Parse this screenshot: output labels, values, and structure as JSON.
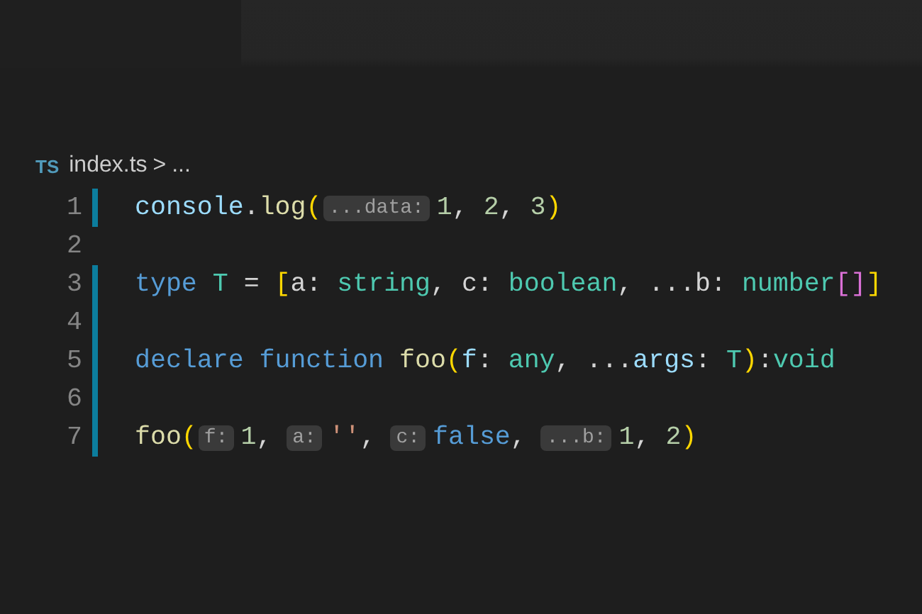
{
  "breadcrumb": {
    "language_badge": "TS",
    "file": "index.ts",
    "separator": ">",
    "rest": "..."
  },
  "lines": [
    {
      "number": "1",
      "modified": true,
      "tokens": [
        {
          "text": "console",
          "kind": "var"
        },
        {
          "text": ".",
          "kind": "punct"
        },
        {
          "text": "log",
          "kind": "fn"
        },
        {
          "text": "(",
          "kind": "bracket"
        },
        {
          "text": "...data:",
          "kind": "hint"
        },
        {
          "text": "1",
          "kind": "num"
        },
        {
          "text": ",",
          "kind": "punct"
        },
        {
          "text": "2",
          "kind": "num",
          "gap": true
        },
        {
          "text": ",",
          "kind": "punct"
        },
        {
          "text": "3",
          "kind": "num",
          "gap": true
        },
        {
          "text": ")",
          "kind": "bracket"
        }
      ]
    },
    {
      "number": "2",
      "modified": false
    },
    {
      "number": "3",
      "modified": true,
      "tokens": [
        {
          "text": "type",
          "kind": "kw"
        },
        {
          "text": "T",
          "kind": "type",
          "gap": true
        },
        {
          "text": "=",
          "kind": "punct",
          "gap": true
        },
        {
          "text": "[",
          "kind": "bracket",
          "gap": true
        },
        {
          "text": "a:",
          "kind": "punct"
        },
        {
          "text": "string",
          "kind": "type",
          "gap": true
        },
        {
          "text": ",",
          "kind": "punct"
        },
        {
          "text": "c:",
          "kind": "punct",
          "gap": true
        },
        {
          "text": "boolean",
          "kind": "type",
          "gap": true
        },
        {
          "text": ",",
          "kind": "punct"
        },
        {
          "text": "...b:",
          "kind": "punct",
          "gap": true
        },
        {
          "text": "number",
          "kind": "type",
          "gap": true
        },
        {
          "text": "[]",
          "kind": "bracket2"
        },
        {
          "text": "]",
          "kind": "bracket"
        }
      ]
    },
    {
      "number": "4",
      "modified": true
    },
    {
      "number": "5",
      "modified": true,
      "tokens": [
        {
          "text": "declare",
          "kind": "kw"
        },
        {
          "text": "function",
          "kind": "kw",
          "gap": true
        },
        {
          "text": "foo",
          "kind": "fn",
          "gap": true
        },
        {
          "text": "(",
          "kind": "bracket"
        },
        {
          "text": "f",
          "kind": "var"
        },
        {
          "text": ":",
          "kind": "punct"
        },
        {
          "text": "any",
          "kind": "type",
          "gap": true
        },
        {
          "text": ",",
          "kind": "punct"
        },
        {
          "text": "...",
          "kind": "punct",
          "gap": true
        },
        {
          "text": "args",
          "kind": "var"
        },
        {
          "text": ":",
          "kind": "punct"
        },
        {
          "text": "T",
          "kind": "type",
          "gap": true
        },
        {
          "text": ")",
          "kind": "bracket"
        },
        {
          "text": ":",
          "kind": "punct"
        },
        {
          "text": "void",
          "kind": "type"
        }
      ]
    },
    {
      "number": "6",
      "modified": true
    },
    {
      "number": "7",
      "modified": true,
      "tokens": [
        {
          "text": "foo",
          "kind": "fn"
        },
        {
          "text": "(",
          "kind": "bracket"
        },
        {
          "text": "f:",
          "kind": "hint"
        },
        {
          "text": "1",
          "kind": "num"
        },
        {
          "text": ",",
          "kind": "punct"
        },
        {
          "text": "a:",
          "kind": "hint",
          "gap": true
        },
        {
          "text": "''",
          "kind": "str"
        },
        {
          "text": ",",
          "kind": "punct"
        },
        {
          "text": "c:",
          "kind": "hint",
          "gap": true
        },
        {
          "text": "false",
          "kind": "kw"
        },
        {
          "text": ",",
          "kind": "punct"
        },
        {
          "text": "...b:",
          "kind": "hint",
          "gap": true
        },
        {
          "text": "1",
          "kind": "num"
        },
        {
          "text": ",",
          "kind": "punct"
        },
        {
          "text": "2",
          "kind": "num",
          "gap": true
        },
        {
          "text": ")",
          "kind": "bracket"
        }
      ]
    }
  ]
}
